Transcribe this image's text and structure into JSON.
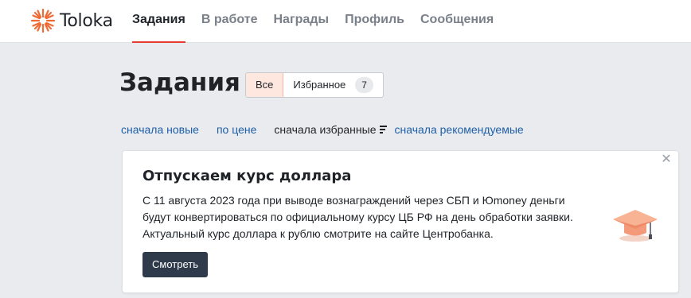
{
  "brand": {
    "name": "Toloka",
    "accent": "#f06a35"
  },
  "nav": {
    "items": [
      {
        "label": "Задания",
        "active": true
      },
      {
        "label": "В работе",
        "active": false
      },
      {
        "label": "Награды",
        "active": false
      },
      {
        "label": "Профиль",
        "active": false
      },
      {
        "label": "Сообщения",
        "active": false
      }
    ]
  },
  "page": {
    "title": "Задания"
  },
  "filter": {
    "all_label": "Все",
    "favorites_label": "Избранное",
    "favorites_count": "7",
    "selected": "Все"
  },
  "sort": {
    "options": [
      "сначала новые",
      "по цене",
      "сначала избранные",
      "сначала рекомендуемые"
    ],
    "active": "сначала избранные"
  },
  "banner": {
    "title": "Отпускаем курс доллара",
    "lines": [
      "С 11 августа 2023 года при выводе вознаграждений через СБП и Юmoney деньги",
      "будут конвертироваться по официальному курсу ЦБ РФ на день обработки заявки.",
      "Актуальный курс доллара к рублю смотрите на сайте Центробанка."
    ],
    "button_label": "Смотреть",
    "close_icon": "close-icon",
    "illustration": "graduation-cap-icon"
  }
}
